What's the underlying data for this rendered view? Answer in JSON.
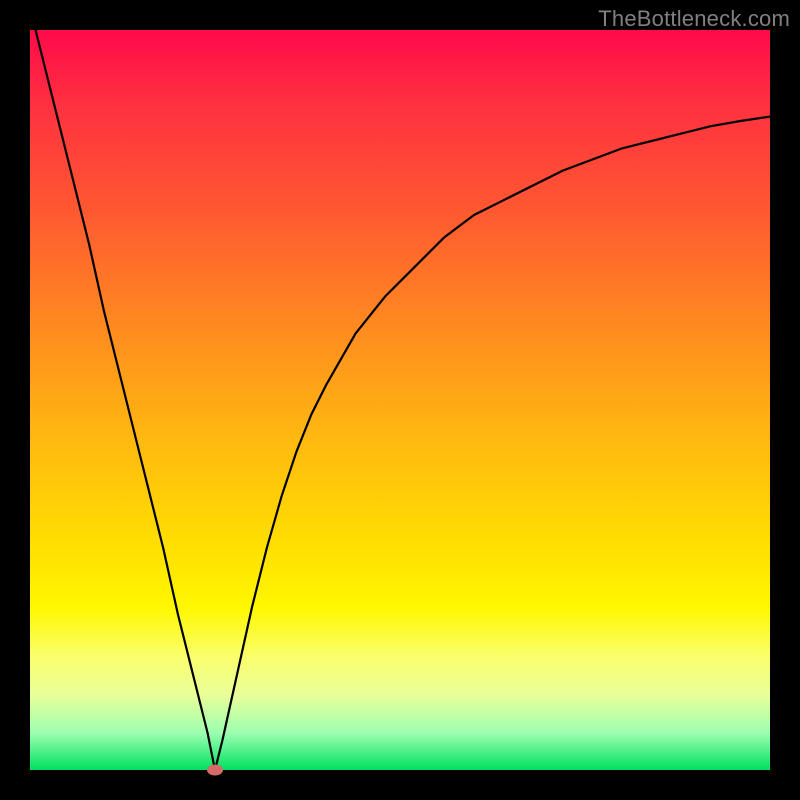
{
  "watermark": "TheBottleneck.com",
  "chart_data": {
    "type": "line",
    "title": "",
    "xlabel": "",
    "ylabel": "",
    "xlim": [
      0,
      100
    ],
    "ylim": [
      0,
      100
    ],
    "grid": false,
    "legend": false,
    "optimum_x": 25,
    "marker": {
      "x": 25,
      "y": 0
    },
    "series": [
      {
        "name": "bottleneck-curve",
        "x": [
          0,
          2,
          4,
          6,
          8,
          10,
          12,
          14,
          16,
          18,
          20,
          22,
          24,
          25,
          26,
          28,
          30,
          32,
          34,
          36,
          38,
          40,
          44,
          48,
          52,
          56,
          60,
          64,
          68,
          72,
          76,
          80,
          84,
          88,
          92,
          96,
          100
        ],
        "values": [
          103,
          95,
          87,
          79,
          71,
          62,
          54,
          46,
          38,
          30,
          21,
          13,
          5,
          0,
          4,
          13,
          22,
          30,
          37,
          43,
          48,
          52,
          59,
          64,
          68,
          72,
          75,
          77,
          79,
          81,
          82.5,
          84,
          85,
          86,
          87,
          87.7,
          88.3
        ]
      }
    ]
  }
}
